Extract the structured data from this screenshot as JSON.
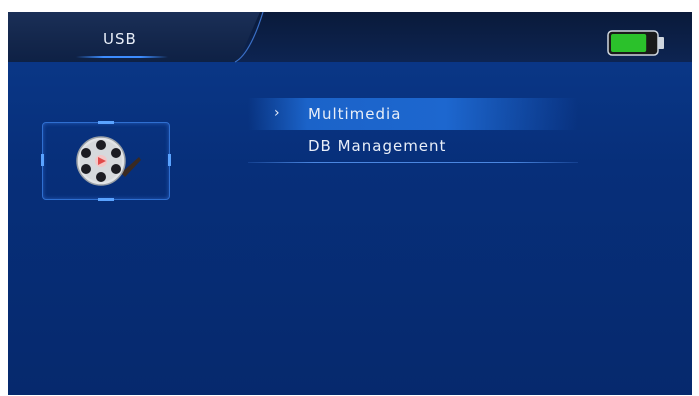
{
  "header": {
    "tab_label": "USB",
    "battery": {
      "level": 0.8,
      "color": "#2bc12b",
      "icon": "battery-icon"
    }
  },
  "category": {
    "icon": "film-reel-icon"
  },
  "menu": {
    "items": [
      {
        "label": "Multimedia",
        "selected": true,
        "marker": "›"
      },
      {
        "label": "DB Management",
        "selected": false
      }
    ]
  },
  "colors": {
    "background": "#072f7a",
    "highlight": "#1d67cf",
    "text": "#e8eef8"
  }
}
